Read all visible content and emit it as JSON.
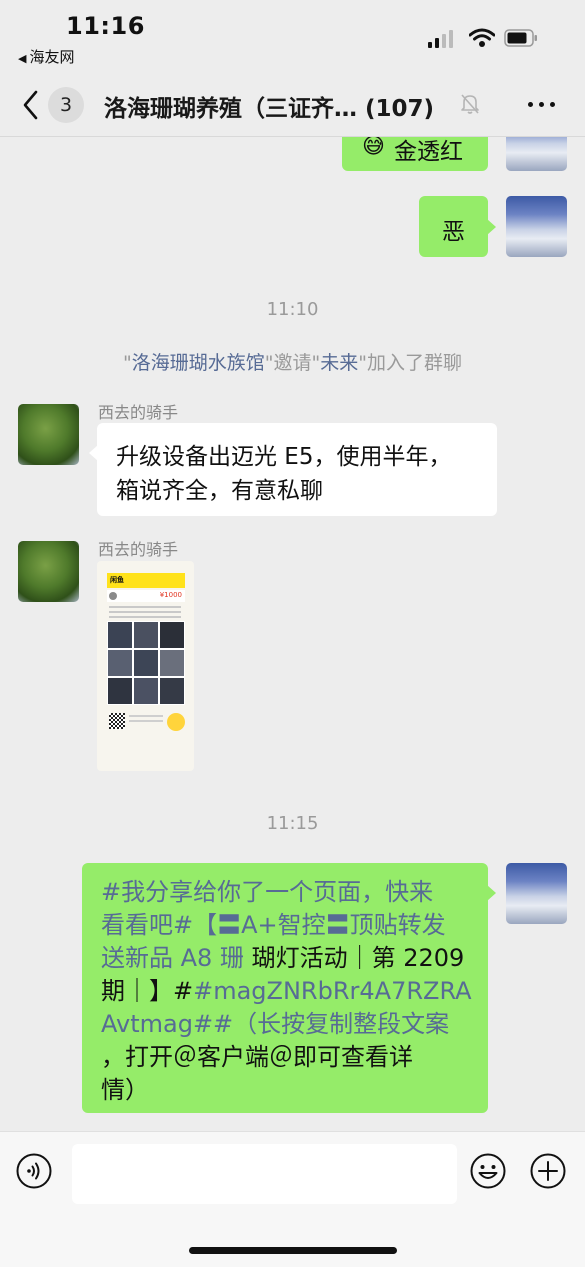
{
  "status_bar": {
    "time": "11:16",
    "back_app": "海友网"
  },
  "nav": {
    "unread_count": "3",
    "title": "洛海珊瑚养殖（三证齐… (107)"
  },
  "messages": {
    "m1_text": "金透红",
    "m2_text": "恶",
    "time_1110": "11:10",
    "system": {
      "quote_open": "\"",
      "inviter": "洛海珊瑚水族馆",
      "mid": "\"邀请\"",
      "invitee": "未来",
      "suffix": "\"加入了群聊"
    },
    "m3_sender": "西去的骑手",
    "m3_line1": "升级设备出迈光 E5，使用半年，",
    "m3_line2": "箱说齐全，有意私聊",
    "m4_sender": "西去的骑手",
    "image_card": {
      "header": "闲鱼",
      "price": "¥1000"
    },
    "time_1115": "11:15",
    "m5": {
      "line1": "#我分享给你了一个页面，快来",
      "line2": "看看吧#【〓A+智控〓顶贴转发",
      "line3_link": "送新品 A8 珊",
      "line3_rest": " 瑚灯活动｜第 2209",
      "line4_black": "期｜】#",
      "line4_link": "#magZNRbRr4A7RZRA",
      "line5": "Avtmag##（长按复制整段文案",
      "line6": "，打开＠客户端＠即可查看详",
      "line7": "情）"
    }
  },
  "input_bar": {
    "placeholder": ""
  },
  "colors": {
    "bubble_me": "#95ec69",
    "link": "#576b95",
    "background": "#ededed"
  }
}
